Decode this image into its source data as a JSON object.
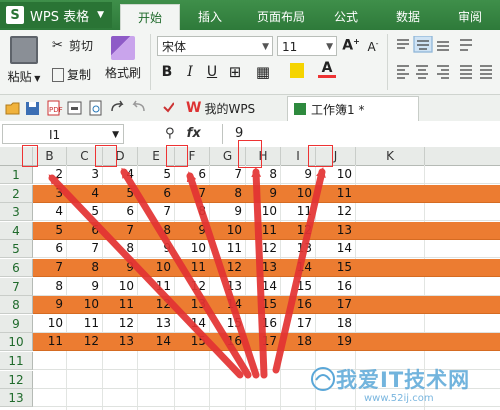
{
  "app": {
    "title": "WPS 表格"
  },
  "ribbon_tabs": [
    "开始",
    "插入",
    "页面布局",
    "公式",
    "数据",
    "审阅"
  ],
  "clipboard": {
    "paste": "粘贴",
    "cut": "剪切",
    "copy": "复制",
    "format_painter": "格式刷"
  },
  "font": {
    "name": "宋体",
    "size": "11"
  },
  "font_style_labels": {
    "bold": "B",
    "italic": "I",
    "underline": "U",
    "font_color": "A"
  },
  "doc_tabs": {
    "wps_home": "我的WPS",
    "workbook": "工作簿1 *"
  },
  "formula_bar": {
    "cell_ref": "I1",
    "fx": "fx",
    "value": "9"
  },
  "columns": [
    "A",
    "B",
    "C",
    "D",
    "E",
    "F",
    "G",
    "H",
    "I",
    "J",
    "K"
  ],
  "rows": [
    "1",
    "2",
    "3",
    "4",
    "5",
    "6",
    "7",
    "8",
    "9",
    "10",
    "11",
    "12",
    "13"
  ],
  "sheet": [
    {
      "values": [
        "1",
        "2",
        "3",
        "4",
        "5",
        "6",
        "7",
        "8",
        "9",
        "10"
      ],
      "highlight": false
    },
    {
      "values": [
        "2",
        "3",
        "4",
        "5",
        "6",
        "7",
        "8",
        "9",
        "10",
        "11"
      ],
      "highlight": true
    },
    {
      "values": [
        "3",
        "4",
        "5",
        "6",
        "7",
        "8",
        "9",
        "10",
        "11",
        "12"
      ],
      "highlight": false
    },
    {
      "values": [
        "4",
        "5",
        "6",
        "7",
        "8",
        "9",
        "10",
        "11",
        "12",
        "13"
      ],
      "highlight": true
    },
    {
      "values": [
        "5",
        "6",
        "7",
        "8",
        "9",
        "10",
        "11",
        "12",
        "13",
        "14"
      ],
      "highlight": false
    },
    {
      "values": [
        "6",
        "7",
        "8",
        "9",
        "10",
        "11",
        "12",
        "13",
        "14",
        "15"
      ],
      "highlight": true
    },
    {
      "values": [
        "7",
        "8",
        "9",
        "10",
        "11",
        "12",
        "13",
        "14",
        "15",
        "16"
      ],
      "highlight": false
    },
    {
      "values": [
        "8",
        "9",
        "10",
        "11",
        "12",
        "13",
        "14",
        "15",
        "16",
        "17"
      ],
      "highlight": true
    },
    {
      "values": [
        "9",
        "10",
        "11",
        "12",
        "13",
        "14",
        "15",
        "16",
        "17",
        "18"
      ],
      "highlight": false
    },
    {
      "values": [
        "10",
        "11",
        "12",
        "13",
        "14",
        "15",
        "16",
        "17",
        "18",
        "19"
      ],
      "highlight": true
    }
  ],
  "colors": {
    "accent_green": "#2e7a3a",
    "row_highlight": "#ec7c31",
    "annotation_red": "#e33333"
  },
  "watermark": {
    "text": "我爱IT技术网",
    "url": "www.52ij.com"
  }
}
